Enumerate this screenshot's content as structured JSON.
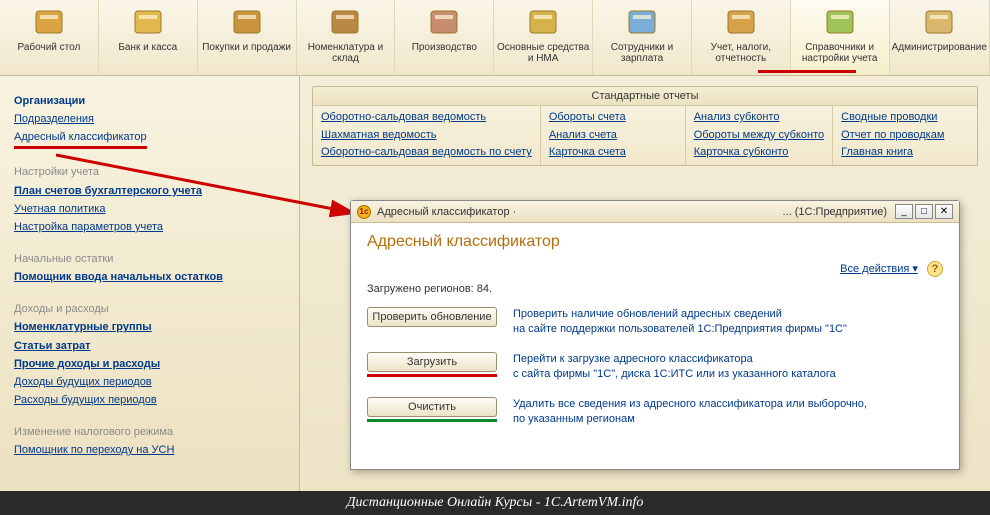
{
  "toolbar": [
    {
      "label": "Рабочий стол",
      "icon": "#d9a441"
    },
    {
      "label": "Банк и касса",
      "icon": "#e0b84e"
    },
    {
      "label": "Покупки и продажи",
      "icon": "#c9943b"
    },
    {
      "label": "Номенклатура и склад",
      "icon": "#bb8844"
    },
    {
      "label": "Производство",
      "icon": "#c88c6e"
    },
    {
      "label": "Основные средства и НМА",
      "icon": "#d6b24a"
    },
    {
      "label": "Сотрудники и зарплата",
      "icon": "#7aaed6"
    },
    {
      "label": "Учет, налоги, отчетность",
      "icon": "#d6a24a"
    },
    {
      "label": "Справочники и настройки учета",
      "icon": "#9ec45a",
      "active": true
    },
    {
      "label": "Администрирование",
      "icon": "#d9b86e"
    }
  ],
  "sidebar": {
    "s1_header": "Организации",
    "s1_link1": "Подразделения",
    "s1_link2": "Адресный классификатор",
    "s2_header": "Настройки учета",
    "s2_link1": "План счетов бухгалтерского учета",
    "s2_link2": "Учетная политика",
    "s2_link3": "Настройка параметров учета",
    "s3_header": "Начальные остатки",
    "s3_link1": "Помощник ввода начальных остатков",
    "s4_header": "Доходы и расходы",
    "s4_link1": "Номенклатурные группы",
    "s4_link2": "Статьи затрат",
    "s4_link3": "Прочие доходы и расходы",
    "s4_link4": "Доходы будущих периодов",
    "s4_link5": "Расходы будущих периодов",
    "s5_header": "Изменение налогового режима",
    "s5_link1": "Помощник по переходу на УСН"
  },
  "reports": {
    "title": "Стандартные отчеты",
    "col1": [
      "Оборотно-сальдовая ведомость",
      "Шахматная ведомость",
      "Оборотно-сальдовая ведомость по счету"
    ],
    "col2": [
      "Обороты счета",
      "Анализ счета",
      "Карточка счета"
    ],
    "col3": [
      "Анализ субконто",
      "Обороты между субконто",
      "Карточка субконто"
    ],
    "col4": [
      "Сводные проводки",
      "Отчет по проводкам",
      "Главная книга"
    ]
  },
  "dialog": {
    "title_left": "Адресный классификатор ·",
    "title_right": "... (1С:Предприятие)",
    "heading": "Адресный классификатор",
    "all_actions": "Все действия",
    "status": "Загружено регионов: 84.",
    "btn_check": "Проверить обновление",
    "desc_check": "Проверить наличие обновлений адресных сведений\nна сайте поддержки пользователей 1С:Предприятия фирмы \"1С\"",
    "btn_load": "Загрузить",
    "desc_load": "Перейти к загрузке адресного классификатора\nс сайта фирмы \"1С\", диска 1С:ИТС или из указанного каталога",
    "btn_clear": "Очистить",
    "desc_clear": "Удалить все сведения из адресного классификатора или выборочно,\nпо указанным регионам"
  },
  "footer": "Дистанционные Онлайн Курсы - 1C.ArtemVM.info"
}
